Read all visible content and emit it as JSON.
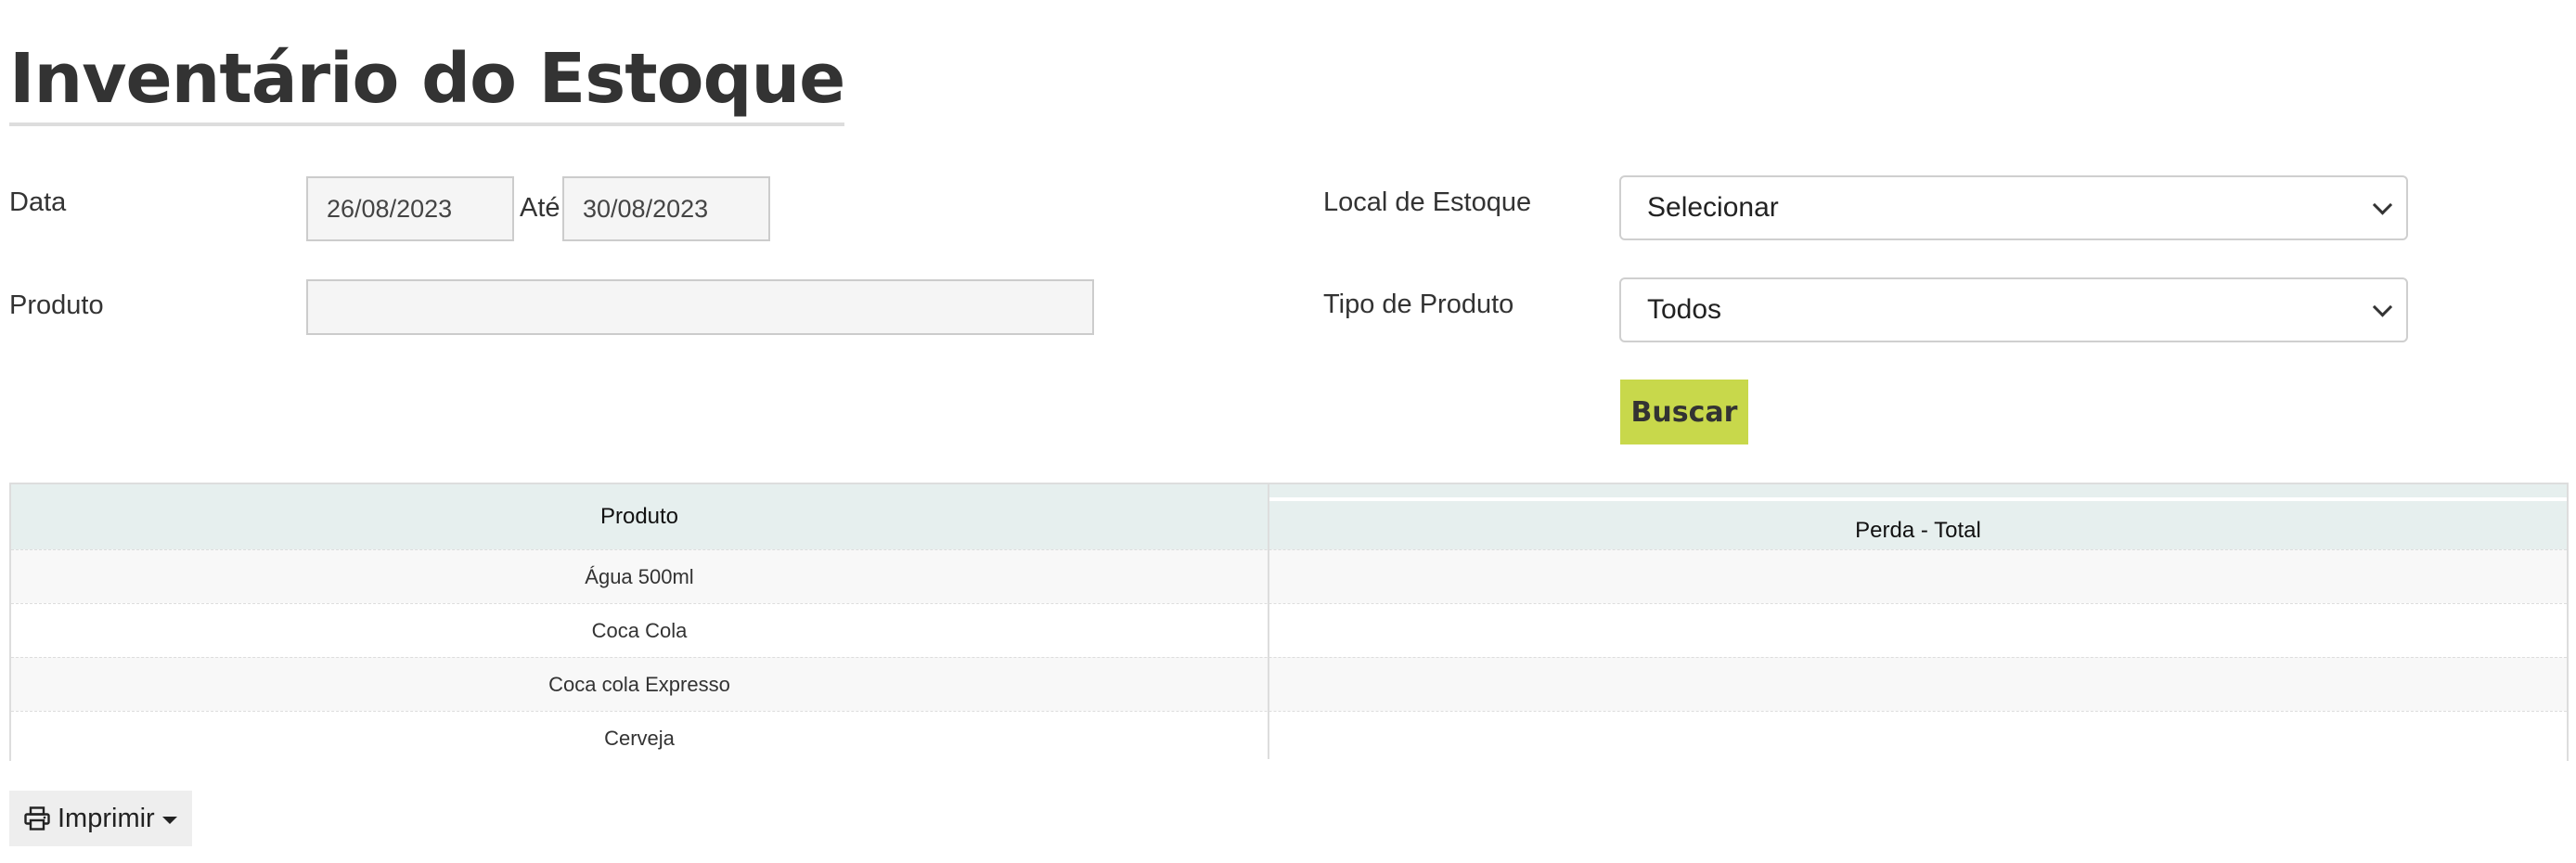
{
  "page": {
    "title": "Inventário do Estoque"
  },
  "filters": {
    "date_label": "Data",
    "date_from": "26/08/2023",
    "date_to_label": "Até",
    "date_to": "30/08/2023",
    "product_label": "Produto",
    "product_value": "",
    "location_label": "Local de Estoque",
    "location_selected": "Selecionar",
    "product_type_label": "Tipo de Produto",
    "product_type_selected": "Todos",
    "search_label": "Buscar"
  },
  "table": {
    "columns": [
      "Produto",
      "Perda - Total"
    ],
    "rows": [
      {
        "product": "Água 500ml",
        "loss_total": ""
      },
      {
        "product": "Coca Cola",
        "loss_total": ""
      },
      {
        "product": "Coca cola Expresso",
        "loss_total": ""
      },
      {
        "product": "Cerveja",
        "loss_total": ""
      }
    ]
  },
  "actions": {
    "print_label": "Imprimir",
    "print_icon": "printer-icon"
  },
  "colors": {
    "accent": "#c8d84b",
    "table_header_bg": "#e6efee",
    "text": "#333333"
  }
}
